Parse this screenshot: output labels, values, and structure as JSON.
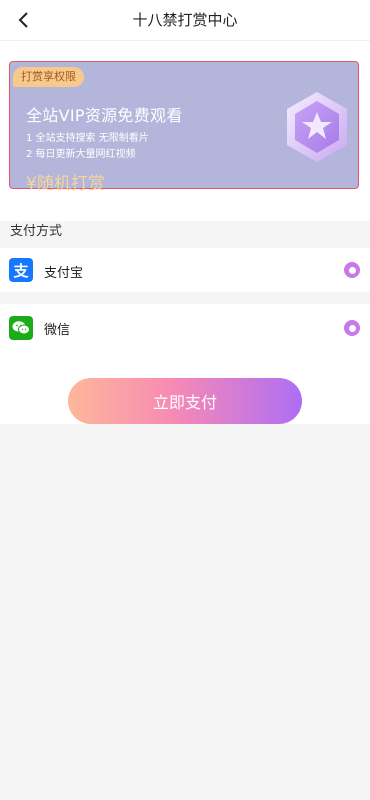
{
  "header": {
    "title": "十八禁打赏中心",
    "back_icon": "chevron-left-icon"
  },
  "promo_card": {
    "badge": "打赏享权限",
    "headline": "全站VIP资源免费观看",
    "benefit_1": "1 全站支持搜索 无限制看片",
    "benefit_2": "2 每日更新大量网红视频",
    "price_label": "¥随机打赏",
    "medal_icon": "star-hexagon-icon",
    "card_bg": "#b3b5db",
    "border_color": "#e05a6a"
  },
  "payment": {
    "section_label": "支付方式",
    "methods": [
      {
        "label": "支付宝",
        "icon": "alipay-icon",
        "icon_glyph": "支",
        "color": "#1677ff",
        "selected": true
      },
      {
        "label": "微信",
        "icon": "wechat-icon",
        "icon_glyph": "",
        "color": "#1aad19",
        "selected": true
      }
    ],
    "radio_color": "#c879e8"
  },
  "action": {
    "pay_label": "立即支付"
  }
}
